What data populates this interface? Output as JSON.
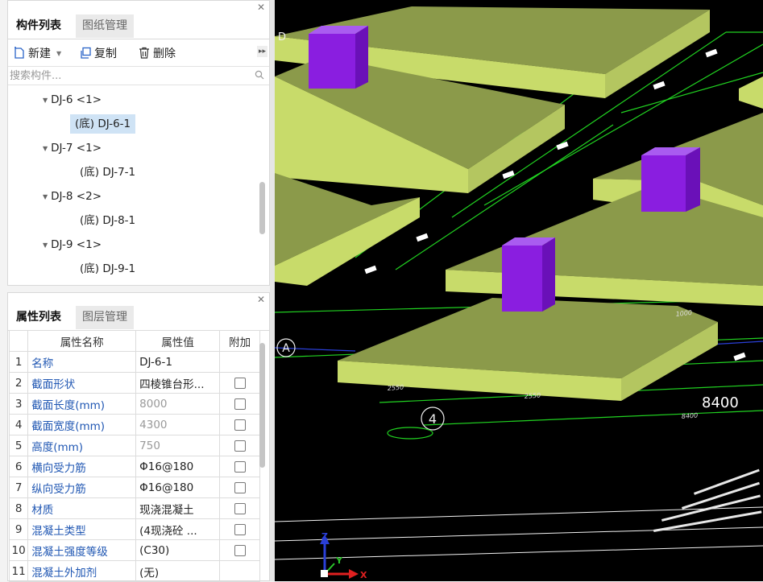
{
  "component_panel": {
    "tabs": [
      "构件列表",
      "图纸管理"
    ],
    "toolbar": {
      "new": "新建",
      "copy": "复制",
      "delete": "删除"
    },
    "search_placeholder": "搜索构件...",
    "tree": [
      {
        "label": "DJ-6 <1>",
        "level": 0,
        "selected": false
      },
      {
        "label": "(底) DJ-6-1",
        "level": 1,
        "selected": true
      },
      {
        "label": "DJ-7 <1>",
        "level": 0,
        "selected": false
      },
      {
        "label": "(底) DJ-7-1",
        "level": 1,
        "selected": false
      },
      {
        "label": "DJ-8 <2>",
        "level": 0,
        "selected": false
      },
      {
        "label": "(底) DJ-8-1",
        "level": 1,
        "selected": false
      },
      {
        "label": "DJ-9 <1>",
        "level": 0,
        "selected": false
      },
      {
        "label": "(底) DJ-9-1",
        "level": 1,
        "selected": false
      }
    ]
  },
  "property_panel": {
    "tabs": [
      "属性列表",
      "图层管理"
    ],
    "columns": [
      "属性名称",
      "属性值",
      "附加"
    ],
    "rows": [
      {
        "num": "1",
        "name": "名称",
        "value": "DJ-6-1",
        "grey": false,
        "checkbox": false
      },
      {
        "num": "2",
        "name": "截面形状",
        "value": "四棱锥台形...",
        "grey": false,
        "checkbox": true
      },
      {
        "num": "3",
        "name": "截面长度(mm)",
        "value": "8000",
        "grey": true,
        "checkbox": true
      },
      {
        "num": "4",
        "name": "截面宽度(mm)",
        "value": "4300",
        "grey": true,
        "checkbox": true
      },
      {
        "num": "5",
        "name": "高度(mm)",
        "value": "750",
        "grey": true,
        "checkbox": true
      },
      {
        "num": "6",
        "name": "横向受力筋",
        "value": "Φ16@180",
        "grey": false,
        "checkbox": true
      },
      {
        "num": "7",
        "name": "纵向受力筋",
        "value": "Φ16@180",
        "grey": false,
        "checkbox": true
      },
      {
        "num": "8",
        "name": "材质",
        "value": "现浇混凝土",
        "grey": false,
        "checkbox": true
      },
      {
        "num": "9",
        "name": "混凝土类型",
        "value": "(4现浇砼 ...",
        "grey": false,
        "checkbox": true
      },
      {
        "num": "10",
        "name": "混凝土强度等级",
        "value": "(C30)",
        "grey": false,
        "checkbox": true
      },
      {
        "num": "11",
        "name": "混凝土外加剂",
        "value": "(无)",
        "grey": false,
        "checkbox": false
      }
    ]
  },
  "viewport": {
    "axis_labels": {
      "row_a": "A",
      "col_4": "4",
      "row_d": "D"
    },
    "dimension_main": "8400",
    "dimension_small": [
      "2550",
      "2550",
      "8400",
      "1000"
    ],
    "axis_names": {
      "x": "X",
      "y": "Y",
      "z": "Z"
    },
    "colors": {
      "footing_top": "#8b9a4a",
      "footing_side": "#c8db6a",
      "column": "#8a1ee0",
      "grid": "#21d321"
    }
  }
}
